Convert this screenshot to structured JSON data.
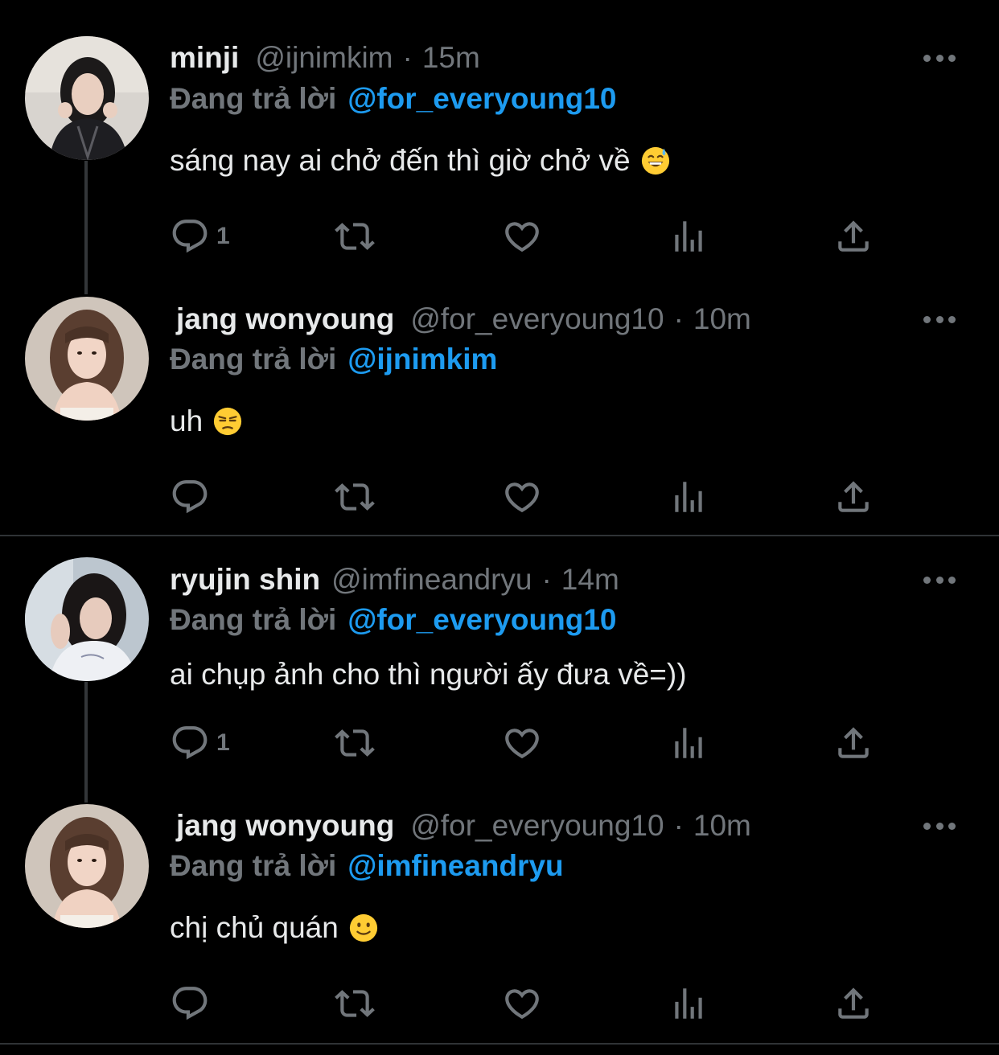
{
  "reply_label": "Đang trả lời",
  "colors": {
    "accent": "#1d9bf0",
    "muted": "#71767b",
    "text": "#e7e9ea",
    "background": "#000000"
  },
  "tweets": [
    {
      "name": "minji",
      "handle": "@ijnimkim",
      "time": "15m",
      "reply_to": "@for_everyoung10",
      "text": "sáng nay ai chở đến thì giờ chở về",
      "emoji": "grinning-sweat-emoji",
      "reply_count": "1"
    },
    {
      "name": "jang wonyoung",
      "handle": "@for_everyoung10",
      "time": "10m",
      "reply_to": "@ijnimkim",
      "text": "uh",
      "emoji": "unamused-emoji",
      "reply_count": ""
    },
    {
      "name": "ryujin shin",
      "handle": "@imfineandryu",
      "time": "14m",
      "reply_to": "@for_everyoung10",
      "text": "ai chụp ảnh cho thì người ấy đưa về=))",
      "emoji": "",
      "reply_count": "1"
    },
    {
      "name": "jang wonyoung",
      "handle": "@for_everyoung10",
      "time": "10m",
      "reply_to": "@imfineandryu",
      "text": "chị chủ quán",
      "emoji": "slightly-smiling-emoji",
      "reply_count": ""
    }
  ],
  "icons": {
    "reply": "reply-icon",
    "retweet": "retweet-icon",
    "like": "heart-icon",
    "views": "views-icon",
    "share": "share-icon",
    "more": "more-icon"
  }
}
